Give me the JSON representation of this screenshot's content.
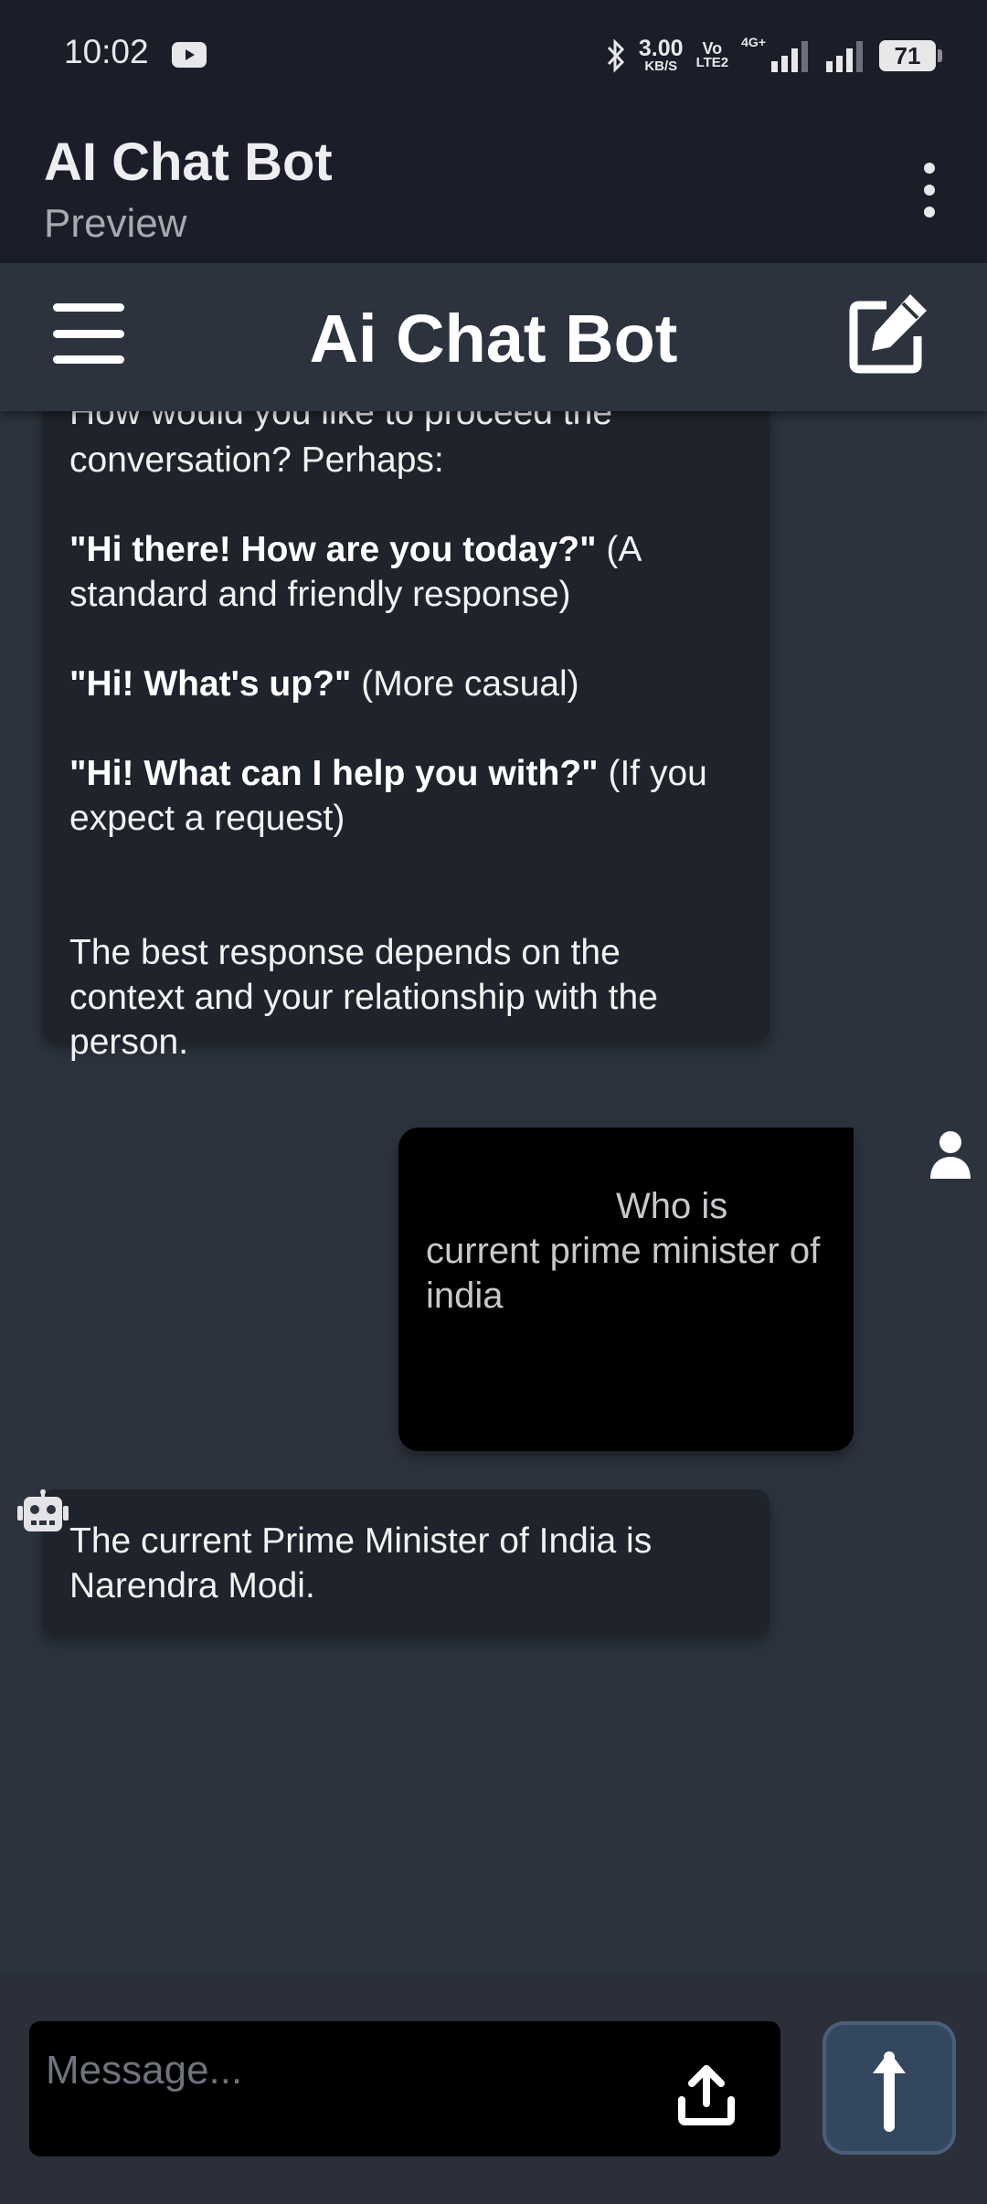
{
  "status_bar": {
    "time": "10:02",
    "net_speed_value": "3.00",
    "net_speed_unit": "KB/S",
    "volte_top": "Vo",
    "volte_bottom": "LTE2",
    "network_tag": "4G+",
    "battery": "71"
  },
  "app_bar": {
    "title": "AI Chat Bot",
    "subtitle": "Preview"
  },
  "header": {
    "title": "Ai Chat Bot"
  },
  "messages": {
    "bot_first": {
      "cut_line": "How would you like to proceed the",
      "intro": "conversation?  Perhaps:",
      "opt1_bold": "\"Hi there! How are you today?\"",
      "opt1_rest": " (A standard and friendly response)",
      "opt2_bold": "\"Hi! What's up?\"",
      "opt2_rest": " (More casual)",
      "opt3_bold": "\"Hi!  What can I help you with?\"",
      "opt3_rest": " (If you expect a request)",
      "closing": "The best response depends on the context and your relationship with the person."
    },
    "user": {
      "text": "Who is current prime minister of india"
    },
    "bot_second": {
      "text": "The current Prime Minister of India is Narendra Modi."
    }
  },
  "composer": {
    "placeholder": "Message..."
  },
  "colors": {
    "background": "#2d333e",
    "top_bar": "#1b1e29",
    "bot_bubble": "#1f232b",
    "user_bubble": "#000000",
    "send_button": "#33475f"
  },
  "icons": {
    "menu": "hamburger-icon",
    "edit": "edit-icon",
    "user": "user-icon",
    "bot": "robot-icon",
    "upload": "upload-icon",
    "send": "arrow-up-icon"
  }
}
